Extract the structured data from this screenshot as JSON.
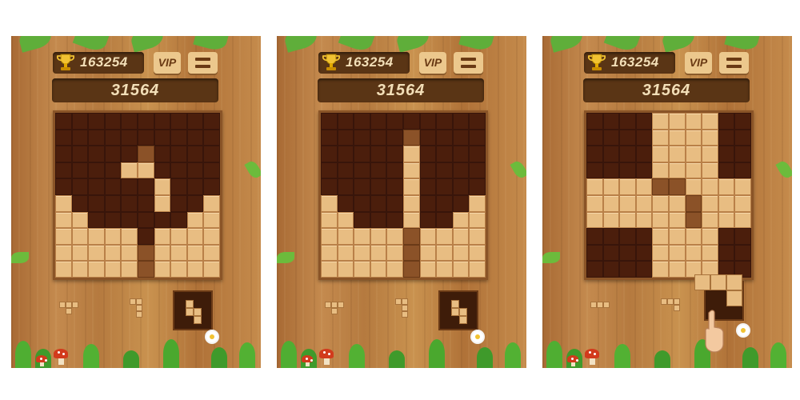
{
  "screens": [
    {
      "best_score": "163254",
      "vip_label": "VIP",
      "current_score": "31564",
      "board": [
        "eeeeeeeeee",
        "eeeeeeeeee",
        "eeeeedeeee",
        "eeeeffeeee",
        "eeeeeefeee",
        "feeeeefeef",
        "ffeeeeeeff",
        "fffffeffff",
        "fffffdffff",
        "fffffdffff"
      ],
      "tray": [
        {
          "type": "piece",
          "cells": [
            [
              0,
              0
            ],
            [
              1,
              0
            ],
            [
              2,
              0
            ],
            [
              1,
              1
            ]
          ]
        },
        {
          "type": "piece",
          "cells": [
            [
              0,
              0
            ],
            [
              1,
              0
            ],
            [
              1,
              1
            ],
            [
              1,
              2
            ]
          ]
        },
        {
          "type": "selected",
          "cells": [
            [
              0,
              0
            ],
            [
              0,
              1
            ],
            [
              1,
              1
            ],
            [
              1,
              2
            ]
          ]
        }
      ]
    },
    {
      "best_score": "163254",
      "vip_label": "VIP",
      "current_score": "31564",
      "board": [
        "eeeeeeeeee",
        "eeeeedeeee",
        "eeeeefeeee",
        "eeeeefeeee",
        "eeeeefeeee",
        "feeeefeeef",
        "ffeeefeeff",
        "fffffdffff",
        "fffffdffff",
        "fffffdffff"
      ],
      "tray": [
        {
          "type": "piece",
          "cells": [
            [
              0,
              0
            ],
            [
              1,
              0
            ],
            [
              2,
              0
            ],
            [
              1,
              1
            ]
          ]
        },
        {
          "type": "piece",
          "cells": [
            [
              0,
              0
            ],
            [
              1,
              0
            ],
            [
              1,
              1
            ],
            [
              1,
              2
            ]
          ]
        },
        {
          "type": "selected",
          "cells": [
            [
              0,
              0
            ],
            [
              0,
              1
            ],
            [
              1,
              1
            ],
            [
              1,
              2
            ]
          ]
        }
      ]
    },
    {
      "best_score": "163254",
      "vip_label": "VIP",
      "current_score": "31564",
      "board": [
        "eeeeffffee",
        "eeeeffffee",
        "eeeeffffee",
        "eeeeffffee",
        "ffffddffff",
        "ffffffdfff",
        "ffffffdfff",
        "eeeeffffee",
        "eeeeffffee",
        "eeeeffffee"
      ],
      "tray": [
        {
          "type": "piece",
          "cells": [
            [
              0,
              0
            ],
            [
              1,
              0
            ],
            [
              2,
              0
            ]
          ]
        },
        {
          "type": "piece",
          "cells": [
            [
              0,
              0
            ],
            [
              1,
              0
            ],
            [
              2,
              0
            ],
            [
              2,
              1
            ]
          ]
        },
        {
          "type": "selected_drag",
          "cells": [
            [
              0,
              0
            ],
            [
              1,
              0
            ],
            [
              2,
              0
            ],
            [
              2,
              1
            ]
          ]
        }
      ]
    }
  ],
  "colors": {
    "empty": "#4b1e0c",
    "filled": "#e8bd82",
    "dark": "#8b5228",
    "panel": "#b57a3f"
  },
  "icons": [
    "trophy-icon",
    "menu-icon",
    "leaf-icon",
    "mushroom-icon",
    "flower-icon",
    "pointing-hand-icon"
  ]
}
